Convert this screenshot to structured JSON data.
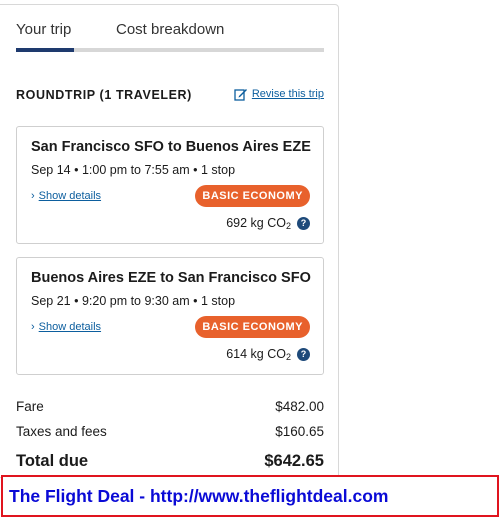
{
  "tabs": [
    {
      "label": "Your trip",
      "active": true
    },
    {
      "label": "Cost breakdown",
      "active": false
    }
  ],
  "trip": {
    "heading": "ROUNDTRIP (1 TRAVELER)",
    "revise_label": "Revise this trip",
    "revise_icon": "edit-icon"
  },
  "flights": [
    {
      "route": "San Francisco SFO to Buenos Aires EZE",
      "schedule": "Sep 14 • 1:00 pm to 7:55 am • 1 stop",
      "details_label": "Show details",
      "fare_class": "BASIC ECONOMY",
      "co2_value": "692 kg CO",
      "co2_sub": "2"
    },
    {
      "route": "Buenos Aires EZE to San Francisco SFO",
      "schedule": "Sep 21 • 9:20 pm to 9:30 am • 1 stop",
      "details_label": "Show details",
      "fare_class": "BASIC ECONOMY",
      "co2_value": "614 kg CO",
      "co2_sub": "2"
    }
  ],
  "costs": {
    "fare_label": "Fare",
    "fare_value": "$482.00",
    "taxes_label": "Taxes and fees",
    "taxes_value": "$160.65",
    "total_label": "Total due",
    "total_value": "$642.65"
  },
  "banner": {
    "text": "The Flight Deal - http://www.theflightdeal.com"
  },
  "colors": {
    "accent_navy": "#1e3a6e",
    "link_blue": "#0c5e9e",
    "badge_orange": "#e8612c",
    "banner_border": "#e0141e",
    "banner_text": "#0a0ad6"
  }
}
